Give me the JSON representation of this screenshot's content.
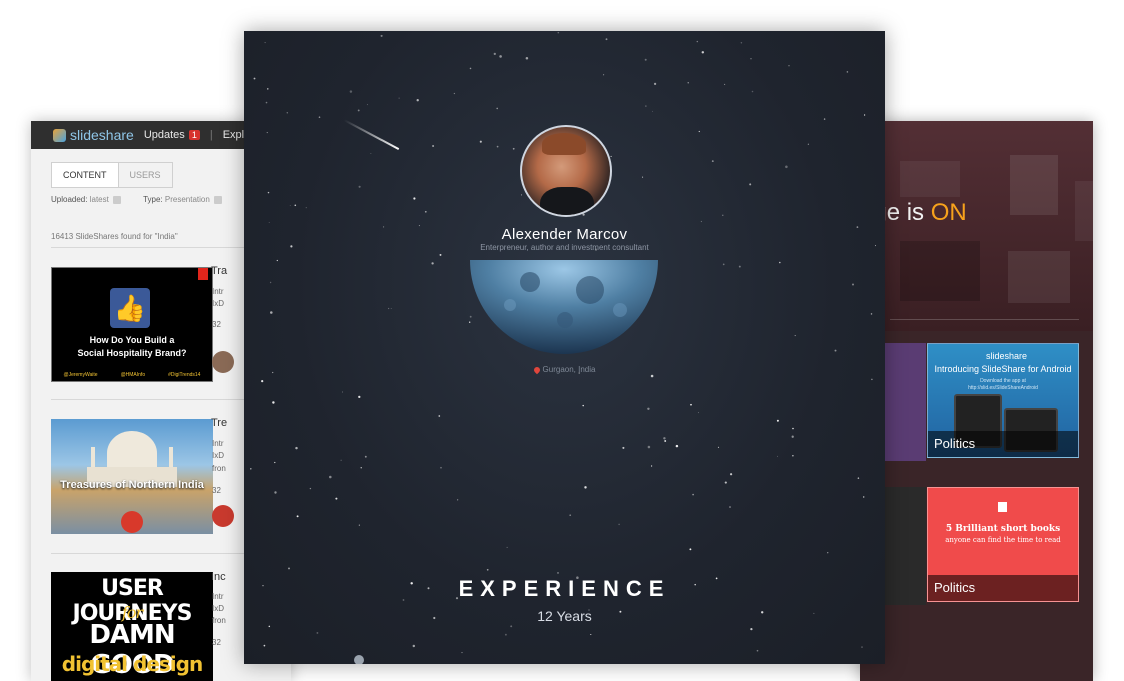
{
  "left_window": {
    "logo_text": "slideshare",
    "nav": {
      "updates_label": "Updates",
      "updates_badge": "1",
      "explore_label": "Explore"
    },
    "tabs": [
      {
        "label": "CONTENT",
        "active": true
      },
      {
        "label": "USERS",
        "active": false
      }
    ],
    "filters": {
      "uploaded_label": "Uploaded:",
      "uploaded_value": "latest",
      "type_label": "Type:",
      "type_value": "Presentation"
    },
    "results_count": "16413 SlideShares found for \"India\"",
    "results": [
      {
        "title_fragment": "Tra",
        "lines": [
          "Intr",
          "IxD"
        ],
        "meta": "32",
        "thumb_text": "How Do You Build a\nSocial Hospitality Brand?",
        "thumb_tags": [
          "@JeremyWaite",
          "@HMAInfo",
          "#DigiTrends14"
        ]
      },
      {
        "title_fragment": "Tre",
        "lines": [
          "Intr",
          "IxD",
          "fron"
        ],
        "meta": "32",
        "thumb_text": "Treasures of Northern India"
      },
      {
        "title_fragment": "Inc",
        "lines": [
          "Intr",
          "IxD",
          "fron"
        ],
        "meta": "32",
        "thumb_lines": [
          "USER JOURNEYS",
          "for",
          "DAMN GOOD",
          "digital design"
        ]
      }
    ]
  },
  "right_window": {
    "headline_prefix": "age is ",
    "headline_highlight": "ON",
    "cards": [
      {
        "label": "Politics",
        "logo": "slideshare",
        "title": "Introducing SlideShare for Android",
        "subtitle": "Download the app at\nhttp://slid.es/SlideShareAndroid"
      },
      {
        "label": "Politics",
        "title": "5 Brilliant short books",
        "subtitle": "anyone can find the time to read"
      }
    ]
  },
  "profile": {
    "name": "Alexender Marcov",
    "tagline": "Enterpreneur, author and investment consultant",
    "location": "Gurgaon, India",
    "experience_heading": "EXPERIENCE",
    "experience_value": "12 Years"
  },
  "colors": {
    "profile_bg": "#1f242e",
    "accent_orange": "#f7a21c",
    "books_red": "#f04b4b",
    "android_blue": "#2f8fc6",
    "badge_red": "#d7322d"
  }
}
